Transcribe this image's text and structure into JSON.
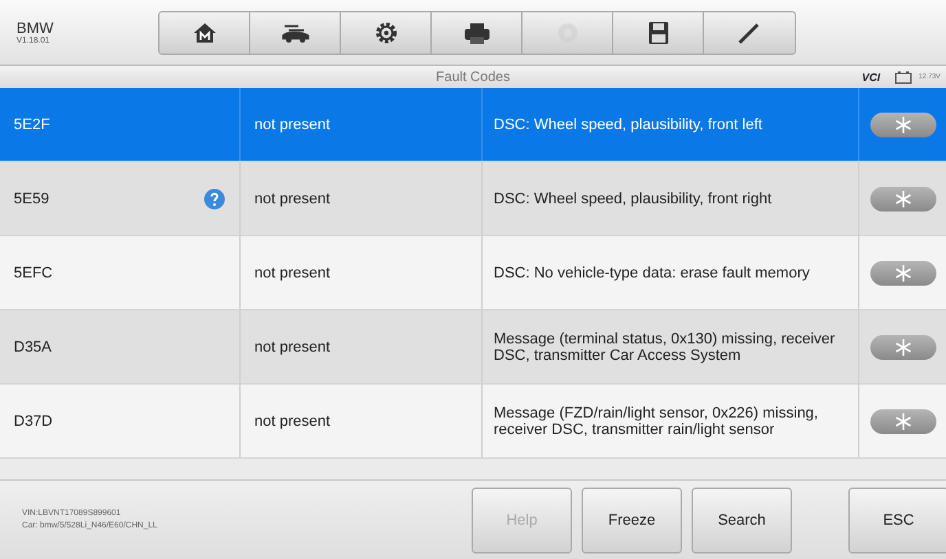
{
  "brand": {
    "name": "BMW",
    "version": "V1.18.01"
  },
  "toolbar": [
    {
      "kind": "home",
      "disabled": false
    },
    {
      "kind": "car",
      "disabled": false
    },
    {
      "kind": "gear",
      "disabled": false
    },
    {
      "kind": "printer",
      "disabled": false
    },
    {
      "kind": "disc",
      "disabled": true
    },
    {
      "kind": "save",
      "disabled": false
    },
    {
      "kind": "pen",
      "disabled": false
    }
  ],
  "title": "Fault Codes",
  "status": {
    "vci": "VCI",
    "voltage": "12.73V"
  },
  "rows": [
    {
      "code": "5E2F",
      "info": false,
      "status": "not present",
      "description": "DSC: Wheel speed, plausibility, front left",
      "selected": true
    },
    {
      "code": "5E59",
      "info": true,
      "status": "not present",
      "description": "DSC: Wheel speed, plausibility, front right",
      "selected": false
    },
    {
      "code": "5EFC",
      "info": false,
      "status": "not present",
      "description": "DSC: No vehicle-type data: erase fault memory",
      "selected": false
    },
    {
      "code": "D35A",
      "info": false,
      "status": "not present",
      "description": "Message (terminal status, 0x130) missing, receiver DSC, transmitter Car Access System",
      "selected": false
    },
    {
      "code": "D37D",
      "info": false,
      "status": "not present",
      "description": "Message (FZD/rain/light sensor, 0x226) missing, receiver DSC, transmitter rain/light sensor",
      "selected": false
    }
  ],
  "vehicle": {
    "vin": "VIN:LBVNT17089S899601",
    "car": "Car: bmw/5/528Li_N46/E60/CHN_LL"
  },
  "buttons": [
    {
      "label": "Help",
      "disabled": true
    },
    {
      "label": "Freeze",
      "disabled": false
    },
    {
      "label": "Search",
      "disabled": false
    },
    {
      "label": "ESC",
      "disabled": false
    }
  ]
}
